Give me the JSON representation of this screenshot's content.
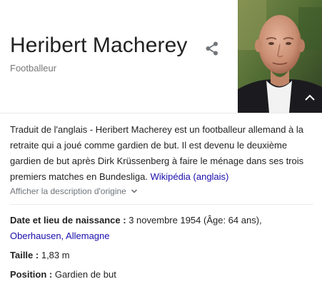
{
  "panel": {
    "title": "Heribert Macherey",
    "subtitle": "Footballeur",
    "share_icon": "share-icon",
    "photo_alt": "Heribert Macherey"
  },
  "description": {
    "text": "Traduit de l'anglais - Heribert Macherey est un footballeur allemand à la retraite qui a joué comme gardien de but. Il est devenu le deuxième gardien de but après Dirk Krüssenberg à faire le ménage dans ses trois premiers matches en Bundesliga.",
    "source_link": "Wikipédia (anglais)",
    "show_original": "Afficher la description d'origine",
    "chevron_icon": "chevron-down-icon"
  },
  "facts": {
    "birth": {
      "label": "Date et lieu de naissance :",
      "value": "3 novembre 1954 (Âge: 64 ans),",
      "link": "Oberhausen, Allemagne"
    },
    "height": {
      "label": "Taille :",
      "value": "1,83 m"
    },
    "position": {
      "label": "Position :",
      "value": "Gardien de but"
    }
  },
  "colors": {
    "link": "#1a0dab",
    "text": "#222222",
    "muted": "#70757a",
    "divider": "#ebebeb"
  }
}
